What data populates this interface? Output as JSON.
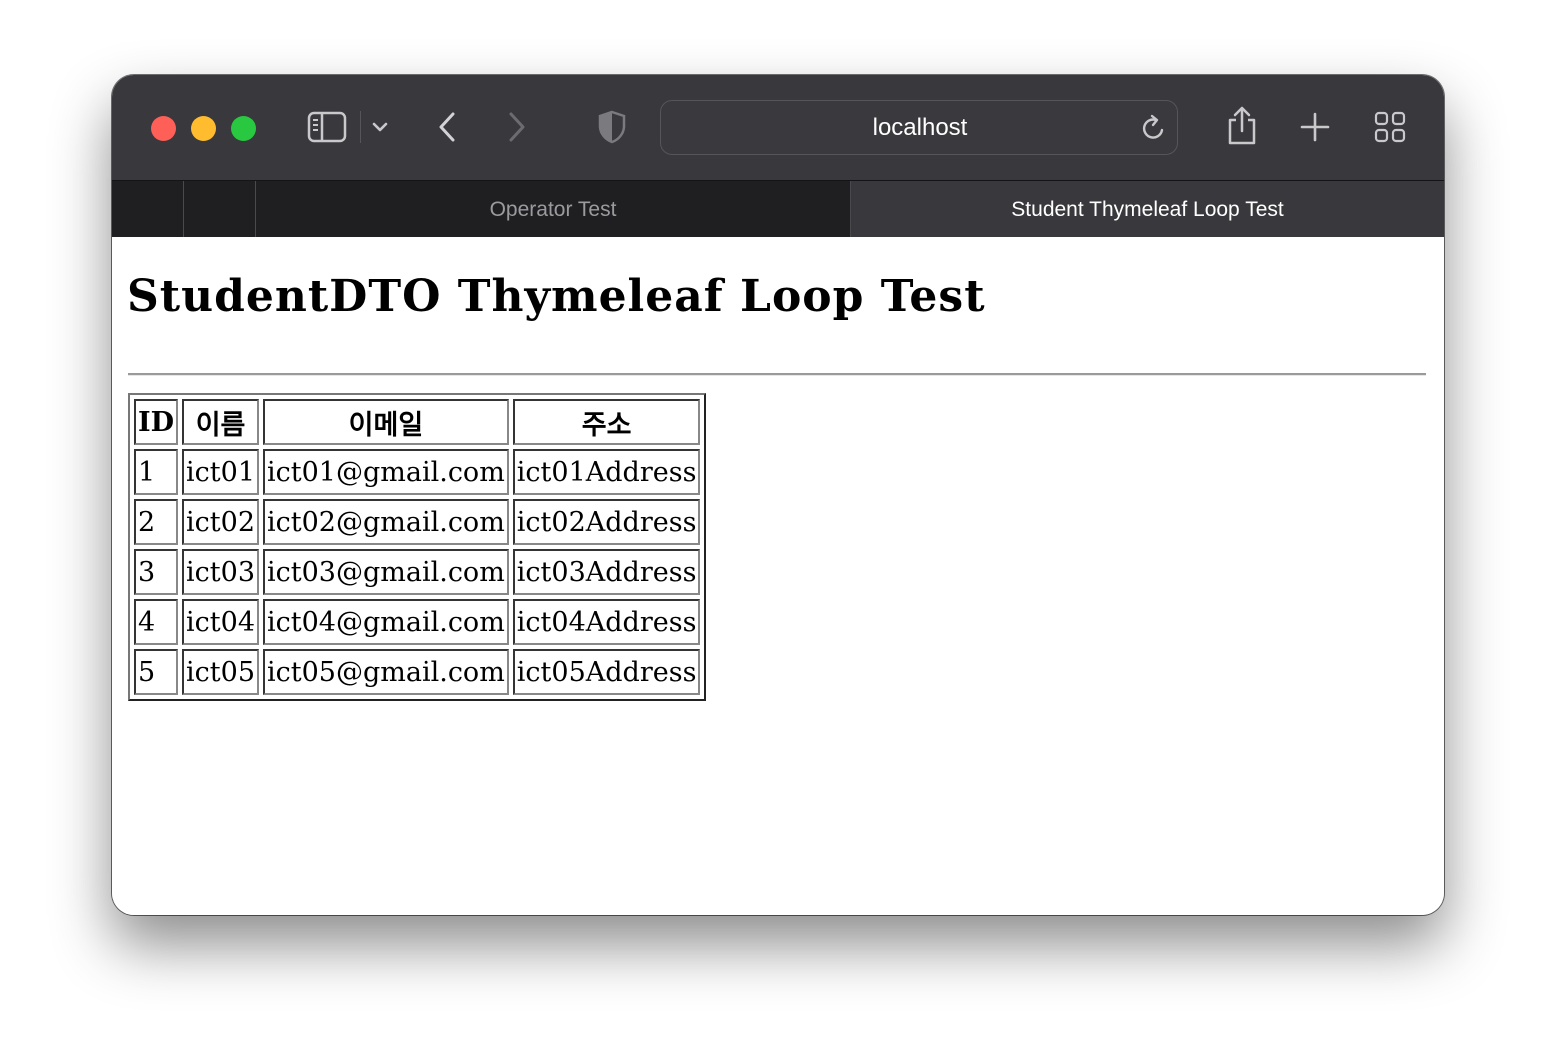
{
  "browser": {
    "url": "localhost",
    "tabs": [
      {
        "label": "Operator Test",
        "active": false
      },
      {
        "label": "Student Thymeleaf Loop Test",
        "active": true
      }
    ],
    "icons": {
      "sidebar": "sidebar-icon",
      "tab_overview": "chevron-down-icon",
      "back": "chevron-left-icon",
      "forward": "chevron-right-icon",
      "privacy": "shield-icon",
      "reload": "reload-icon",
      "share": "share-icon",
      "new_tab": "plus-icon",
      "tab_grid": "grid-icon"
    },
    "colors": {
      "toolbar": "#39383d",
      "tabbar": "#1f1f22",
      "close": "#fe5f57",
      "minimize": "#febc2e",
      "maximize": "#28c840"
    }
  },
  "page": {
    "title": "StudentDTO Thymeleaf Loop Test",
    "table": {
      "headers": [
        "ID",
        "이름",
        "이메일",
        "주소"
      ],
      "rows": [
        [
          "1",
          "ict01",
          "ict01@gmail.com",
          "ict01Address"
        ],
        [
          "2",
          "ict02",
          "ict02@gmail.com",
          "ict02Address"
        ],
        [
          "3",
          "ict03",
          "ict03@gmail.com",
          "ict03Address"
        ],
        [
          "4",
          "ict04",
          "ict04@gmail.com",
          "ict04Address"
        ],
        [
          "5",
          "ict05",
          "ict05@gmail.com",
          "ict05Address"
        ]
      ]
    }
  }
}
